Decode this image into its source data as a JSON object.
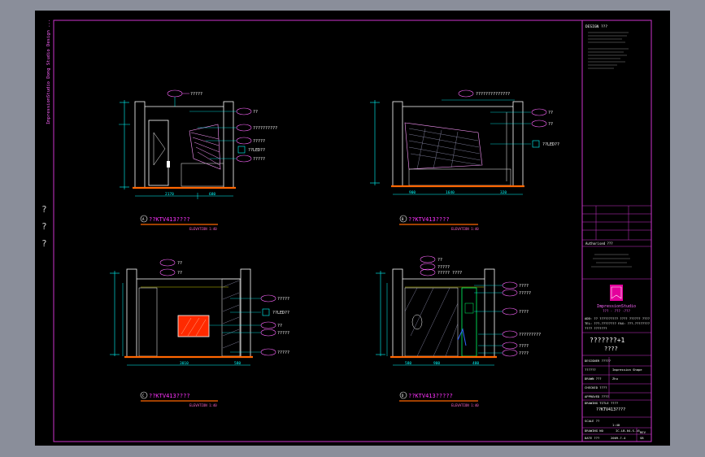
{
  "left_strip": {
    "vertical_text": "ImpressionStudio  Dong  Studio  Design  ..."
  },
  "left_marks": [
    "?",
    "?",
    "?"
  ],
  "views": [
    {
      "id": "A",
      "title": "??KTV413????",
      "subtitle": "ELEVATION 1:40",
      "index": "A",
      "callouts": [
        "?????",
        "??",
        "??????????",
        "?????",
        "??LED??",
        "?????"
      ],
      "dims": [
        "2170",
        "680"
      ]
    },
    {
      "id": "B",
      "title": "??KTV413????",
      "subtitle": "ELEVATION 1:40",
      "index": "B",
      "callouts": [
        "??????????????",
        "??",
        "??",
        "??LED??"
      ],
      "dims": [
        "900",
        "1640",
        "320"
      ]
    },
    {
      "id": "C",
      "title": "??KTV413????",
      "subtitle": "ELEVATION 1:40",
      "index": "C",
      "callouts": [
        "??",
        "??",
        "?????",
        "??LED??",
        "??",
        "?????",
        "?????"
      ],
      "dims": [
        "3010",
        "580"
      ]
    },
    {
      "id": "D",
      "title": "??KTV413?????",
      "subtitle": "ELEVATION 1:40",
      "index": "D",
      "callouts": [
        "??",
        "?????",
        "????? ????",
        "????",
        "?????",
        "????",
        "?????????",
        "????",
        "????"
      ],
      "dims": [
        "580",
        "900",
        "480"
      ]
    }
  ],
  "title_block": {
    "notes_header": "DESIGN ???",
    "company": "ImpressionStudio",
    "company_sub": "??? · ??? ·???",
    "address_lines": [
      "ADD: ?? ?????????? ???? ?????? ????",
      "TEL: ???-???????? FAX: ???-????????",
      "???? ???????"
    ],
    "project_name": "???????+1",
    "project_sub": "????",
    "rows": [
      {
        "label": "DESIGNER ?????",
        "value": ""
      },
      {
        "label": "??????",
        "value": "Impression Shape"
      },
      {
        "label": "DRAWN ???",
        "value": "Zhu"
      },
      {
        "label": "CHECKED ????",
        "value": ""
      },
      {
        "label": "APPROVED ????",
        "value": ""
      },
      {
        "label": "DRAWING TITLE ????",
        "value": "??KTV413????"
      },
      {
        "label": "SCALE ??",
        "value": "1:40"
      },
      {
        "label": "DATE ???",
        "value": "2009-7-4"
      },
      {
        "label": "DRAWING NO",
        "value": "IC-LB-04-S-16"
      }
    ],
    "revision_label": "REV",
    "revision_value": "SB",
    "stamp_label": "Authorised ???"
  },
  "colors": {
    "background": "#000000",
    "border": "#cc33cc",
    "title": "#ff33ff",
    "section": "#ff66cc",
    "dimension": "#00ffff",
    "wall": "#ffffff",
    "floor": "#ff6600",
    "hatch": "#9999bb",
    "tv": "#ff2a00",
    "led": "#00ff66",
    "text": "#ffffff",
    "logo": "#e4009c"
  }
}
